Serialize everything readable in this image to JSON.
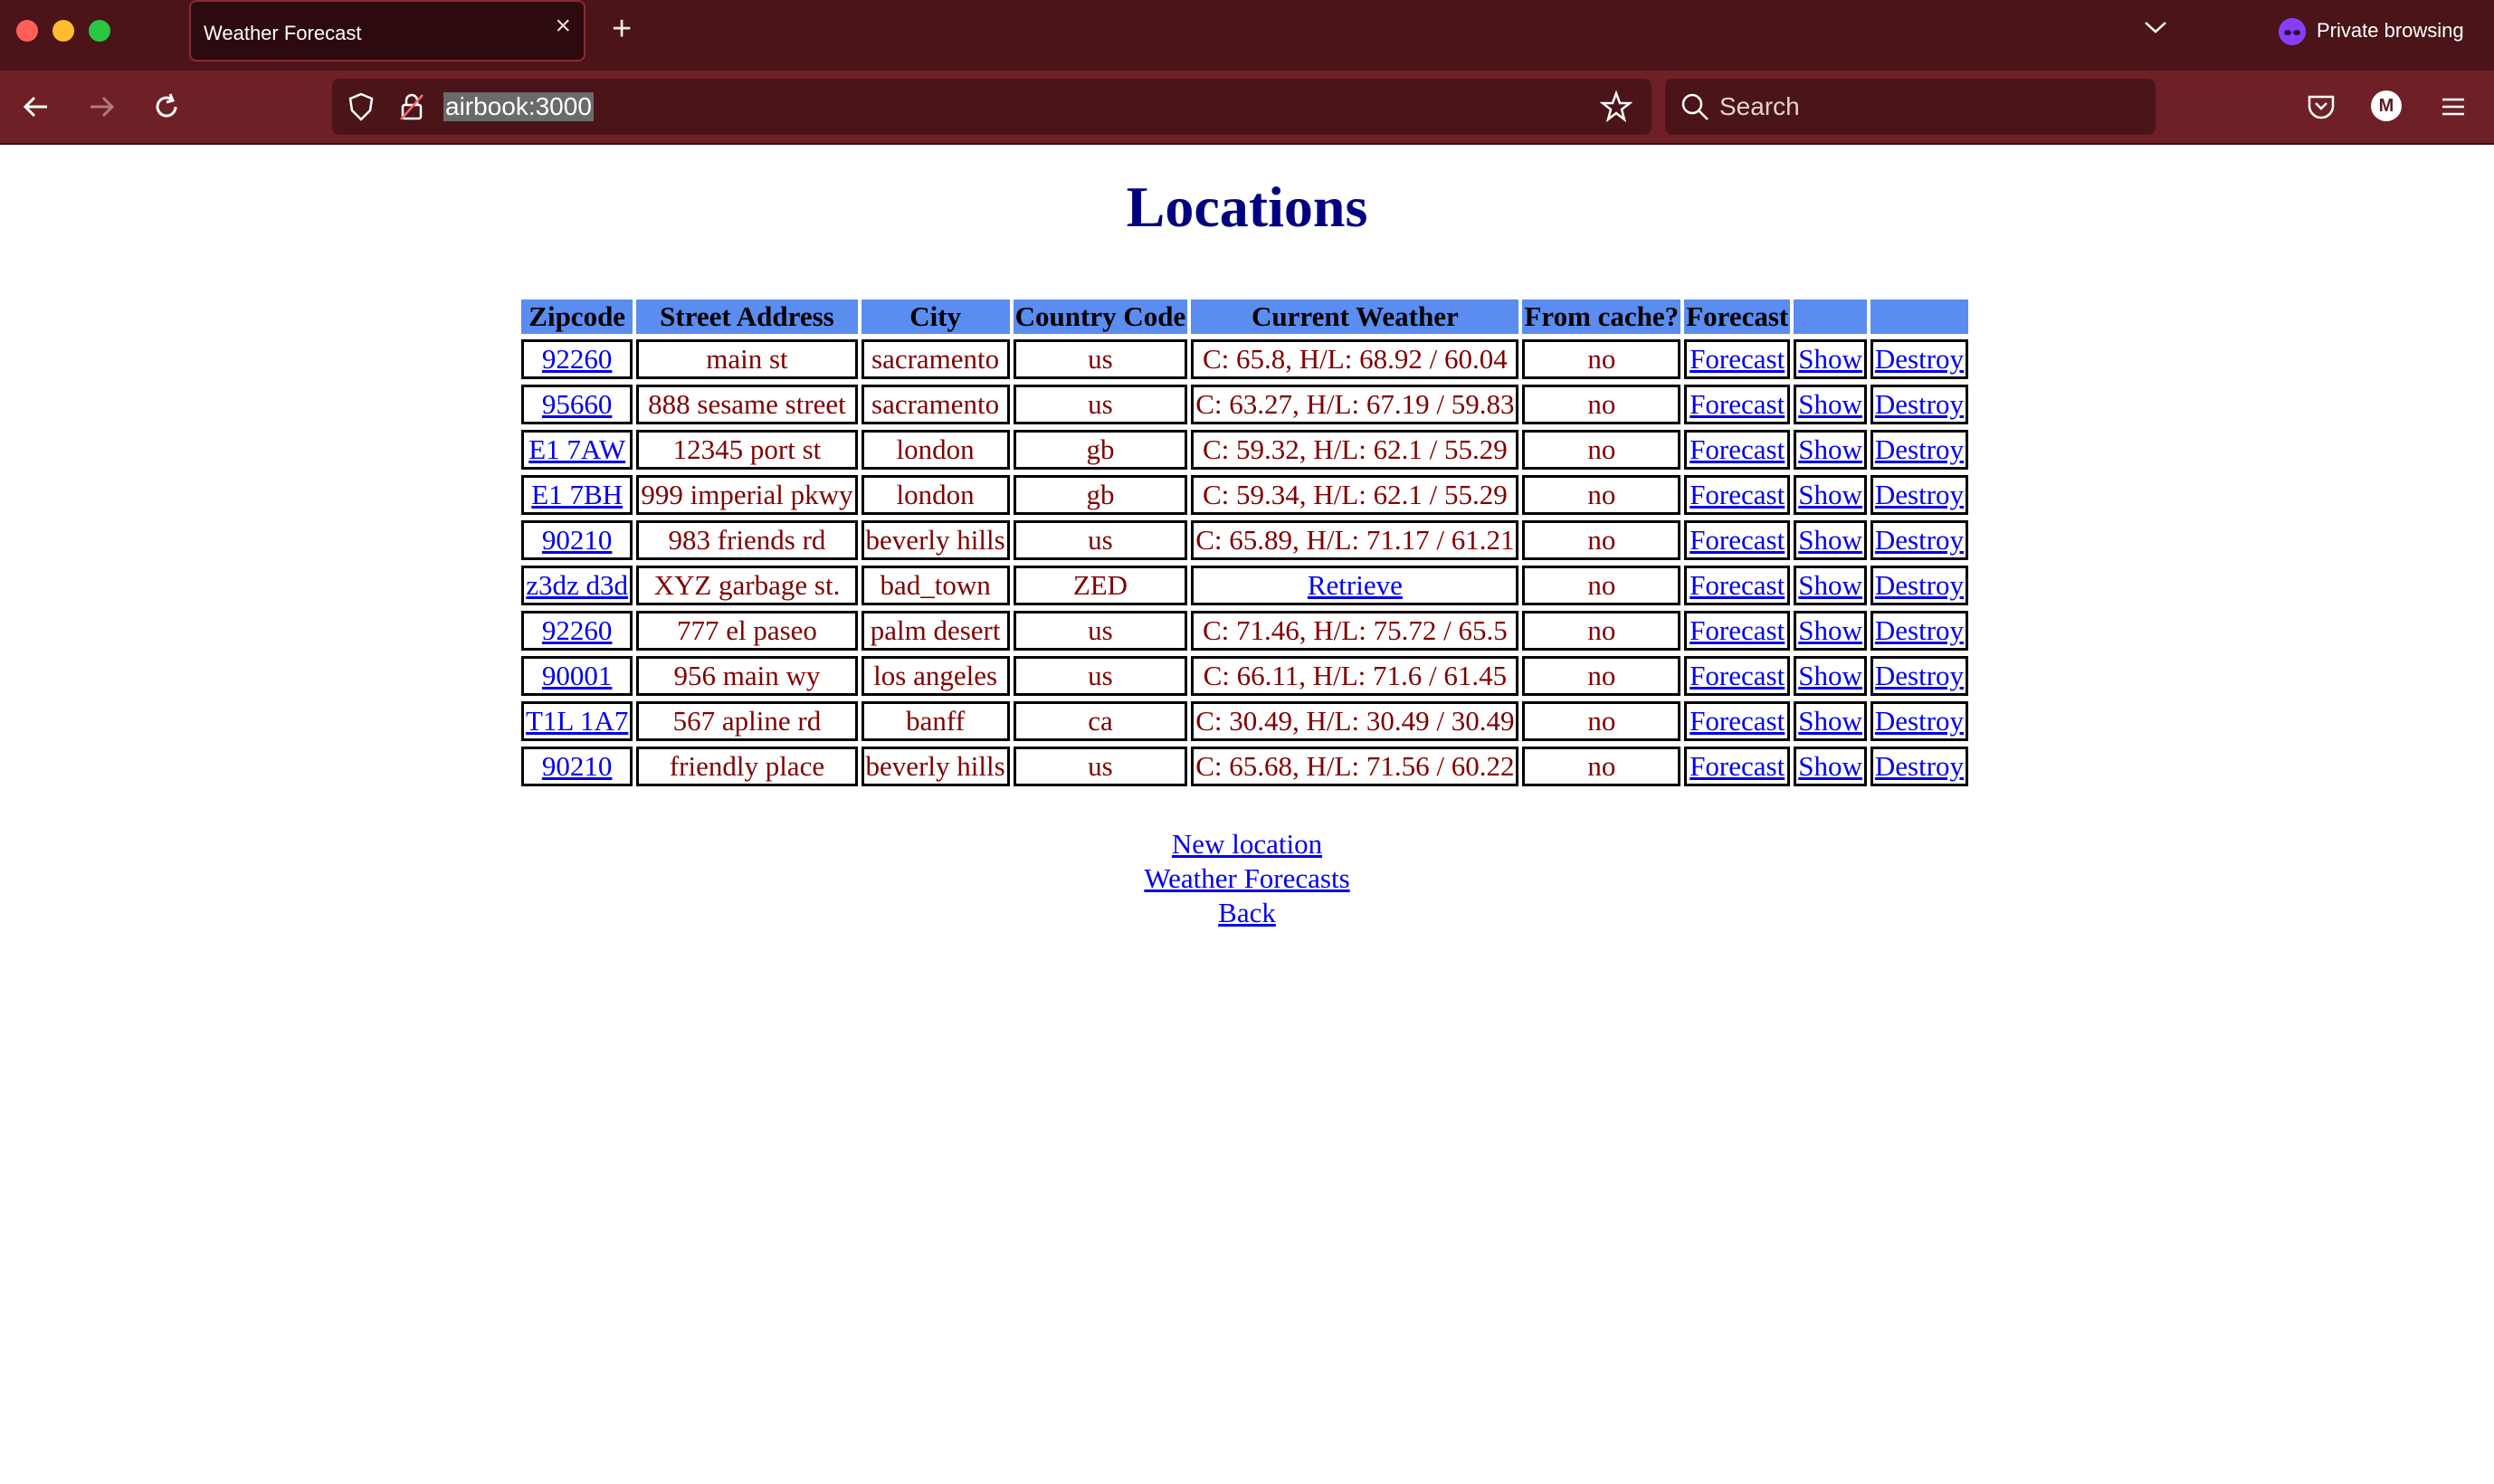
{
  "browser": {
    "tab_title": "Weather Forecast",
    "tab_close_icon": "×",
    "new_tab_icon": "+",
    "private_label": "Private browsing",
    "url": "airbook:3000",
    "search_placeholder": "Search",
    "account_initial": "M",
    "icons": [
      "back-icon",
      "forward-icon",
      "reload-icon",
      "shield-icon",
      "lock-icon",
      "star-icon",
      "search-icon",
      "pocket-icon",
      "menu-icon",
      "chevron-down-icon",
      "private-mask-icon"
    ]
  },
  "page": {
    "title": "Locations",
    "columns": [
      "Zipcode",
      "Street Address",
      "City",
      "Country Code",
      "Current Weather",
      "From cache?",
      "Forecast",
      "",
      ""
    ],
    "rows": [
      {
        "zipcode": "92260",
        "street": "main st",
        "city": "sacramento",
        "country": "us",
        "weather": "C: 65.8, H/L: 68.92 / 60.04",
        "weather_link": false,
        "cache": "no"
      },
      {
        "zipcode": "95660",
        "street": "888 sesame street",
        "city": "sacramento",
        "country": "us",
        "weather": "C: 63.27, H/L: 67.19 / 59.83",
        "weather_link": false,
        "cache": "no"
      },
      {
        "zipcode": "E1 7AW",
        "street": "12345 port st",
        "city": "london",
        "country": "gb",
        "weather": "C: 59.32, H/L: 62.1 / 55.29",
        "weather_link": false,
        "cache": "no"
      },
      {
        "zipcode": "E1 7BH",
        "street": "999 imperial pkwy",
        "city": "london",
        "country": "gb",
        "weather": "C: 59.34, H/L: 62.1 / 55.29",
        "weather_link": false,
        "cache": "no"
      },
      {
        "zipcode": "90210",
        "street": "983 friends rd",
        "city": "beverly hills",
        "country": "us",
        "weather": "C: 65.89, H/L: 71.17 / 61.21",
        "weather_link": false,
        "cache": "no"
      },
      {
        "zipcode": "z3dz d3d",
        "street": "XYZ garbage st.",
        "city": "bad_town",
        "country": "ZED",
        "weather": "Retrieve",
        "weather_link": true,
        "cache": "no"
      },
      {
        "zipcode": "92260",
        "street": "777 el paseo",
        "city": "palm desert",
        "country": "us",
        "weather": "C: 71.46, H/L: 75.72 / 65.5",
        "weather_link": false,
        "cache": "no"
      },
      {
        "zipcode": "90001",
        "street": "956 main wy",
        "city": "los angeles",
        "country": "us",
        "weather": "C: 66.11, H/L: 71.6 / 61.45",
        "weather_link": false,
        "cache": "no"
      },
      {
        "zipcode": "T1L 1A7",
        "street": "567 apline rd",
        "city": "banff",
        "country": "ca",
        "weather": "C: 30.49, H/L: 30.49 / 30.49",
        "weather_link": false,
        "cache": "no"
      },
      {
        "zipcode": "90210",
        "street": "friendly place",
        "city": "beverly hills",
        "country": "us",
        "weather": "C: 65.68, H/L: 71.56 / 60.22",
        "weather_link": false,
        "cache": "no"
      }
    ],
    "row_actions": [
      "Forecast",
      "Show",
      "Destroy"
    ],
    "footer_links": [
      "New location",
      "Weather Forecasts",
      "Back"
    ]
  },
  "colors": {
    "tab_bar": "#4a1419",
    "toolbar": "#6e2026",
    "heading": "#000080",
    "header_row": "#5b8cef",
    "cell_text": "#800000",
    "link": "#0000ee"
  }
}
